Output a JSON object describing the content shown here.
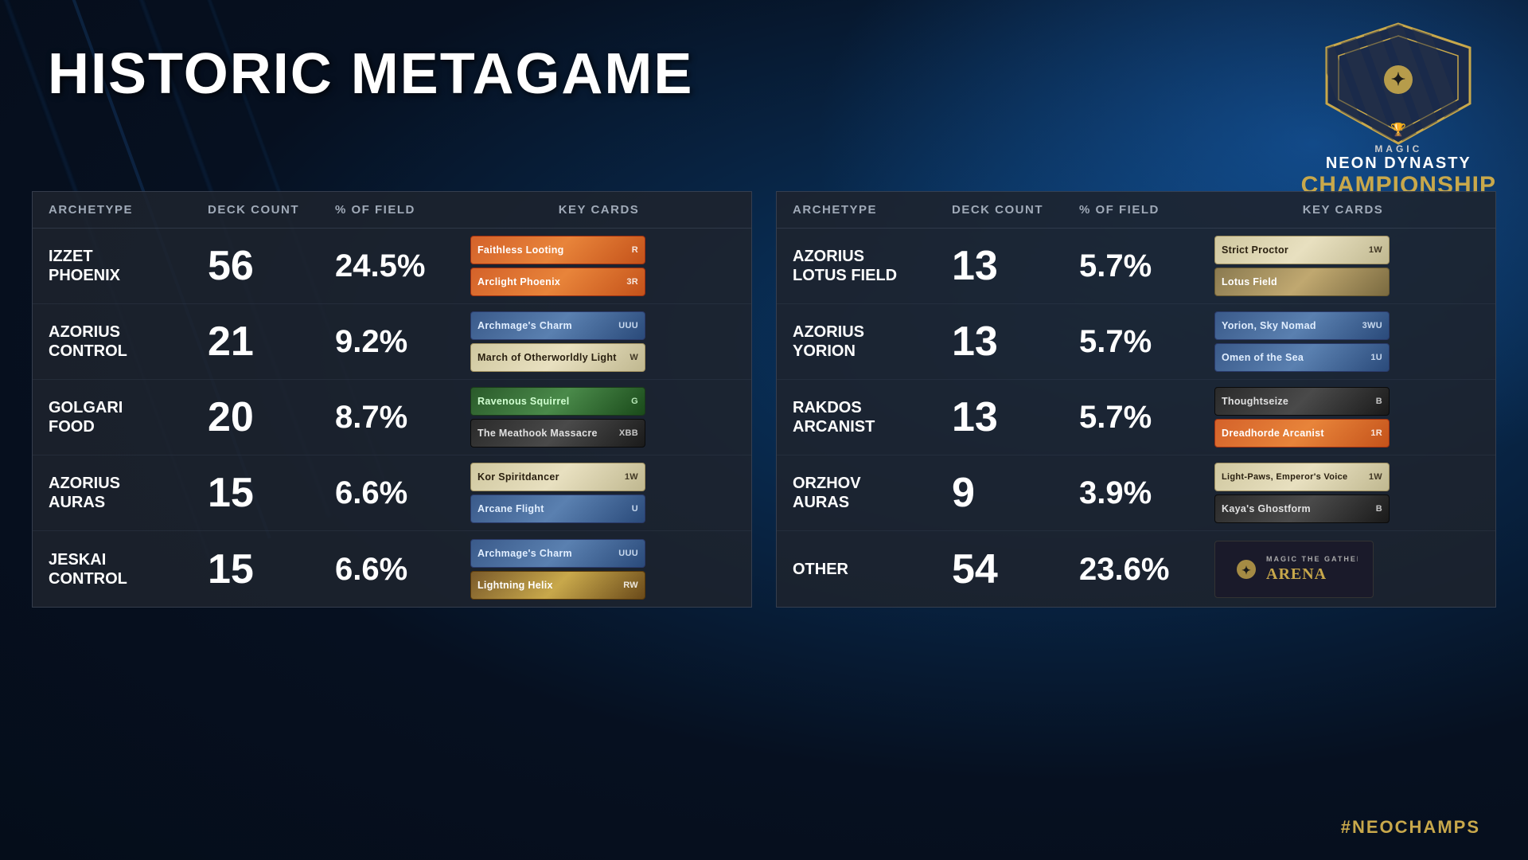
{
  "page": {
    "title": "HISTORIC METAGAME",
    "hashtag": "#NEOCHAMPS"
  },
  "championship": {
    "magic_label": "MAGIC",
    "line1": "NEON DYNASTY",
    "line2": "CHAMPIONSHIP"
  },
  "left_table": {
    "headers": [
      "ARCHETYPE",
      "DECK COUNT",
      "% OF FIELD",
      "KEY CARDS"
    ],
    "rows": [
      {
        "archetype": "IZZET\nPHOENIX",
        "deck_count": "56",
        "pct_field": "24.5%",
        "cards": [
          {
            "name": "Faithless Looting",
            "type": "red-card",
            "cost": "R"
          },
          {
            "name": "Arclight Phoenix",
            "type": "red-card",
            "cost": "3R"
          }
        ]
      },
      {
        "archetype": "AZORIUS\nCONTROL",
        "deck_count": "21",
        "pct_field": "9.2%",
        "cards": [
          {
            "name": "Archmage's Charm",
            "type": "blue-card",
            "cost": "UUU"
          },
          {
            "name": "March of Otherworldly Light",
            "type": "white-card",
            "cost": "W"
          }
        ]
      },
      {
        "archetype": "GOLGARI\nFOOD",
        "deck_count": "20",
        "pct_field": "8.7%",
        "cards": [
          {
            "name": "Ravenous Squirrel",
            "type": "green-card",
            "cost": "G"
          },
          {
            "name": "The Meathook Massacre",
            "type": "dark-card",
            "cost": "XBB"
          }
        ]
      },
      {
        "archetype": "AZORIUS\nAURAS",
        "deck_count": "15",
        "pct_field": "6.6%",
        "cards": [
          {
            "name": "Kor Spiritdancer",
            "type": "white-card",
            "cost": "1W"
          },
          {
            "name": "Arcane Flight",
            "type": "blue-card",
            "cost": "U"
          }
        ]
      },
      {
        "archetype": "JESKAI\nCONTROL",
        "deck_count": "15",
        "pct_field": "6.6%",
        "cards": [
          {
            "name": "Archmage's Charm",
            "type": "blue-card",
            "cost": "UUU"
          },
          {
            "name": "Lightning Helix",
            "type": "multi-card",
            "cost": "RW"
          }
        ]
      }
    ]
  },
  "right_table": {
    "headers": [
      "ARCHETYPE",
      "DECK COUNT",
      "% OF FIELD",
      "KEY CARDS"
    ],
    "rows": [
      {
        "archetype": "AZORIUS\nLOTUS FIELD",
        "deck_count": "13",
        "pct_field": "5.7%",
        "cards": [
          {
            "name": "Strict Proctor",
            "type": "white-card",
            "cost": "1W"
          },
          {
            "name": "Lotus Field",
            "type": "land-card",
            "cost": ""
          }
        ]
      },
      {
        "archetype": "AZORIUS\nYORION",
        "deck_count": "13",
        "pct_field": "5.7%",
        "cards": [
          {
            "name": "Yorion, Sky Nomad",
            "type": "blue-card",
            "cost": "3WU"
          },
          {
            "name": "Omen of the Sea",
            "type": "blue-card",
            "cost": "1U"
          }
        ]
      },
      {
        "archetype": "RAKDOS\nARCANIST",
        "deck_count": "13",
        "pct_field": "5.7%",
        "cards": [
          {
            "name": "Thoughtseize",
            "type": "dark-card",
            "cost": "B"
          },
          {
            "name": "Dreadhorde Arcanist",
            "type": "red-card",
            "cost": "1R"
          }
        ]
      },
      {
        "archetype": "ORZHOV\nAURAS",
        "deck_count": "9",
        "pct_field": "3.9%",
        "cards": [
          {
            "name": "Light-Paws, Emperor's Voice",
            "type": "white-card",
            "cost": "1W"
          },
          {
            "name": "Kaya's Ghostform",
            "type": "dark-card",
            "cost": "B"
          }
        ]
      },
      {
        "archetype": "OTHER",
        "deck_count": "54",
        "pct_field": "23.6%",
        "cards": []
      }
    ]
  }
}
